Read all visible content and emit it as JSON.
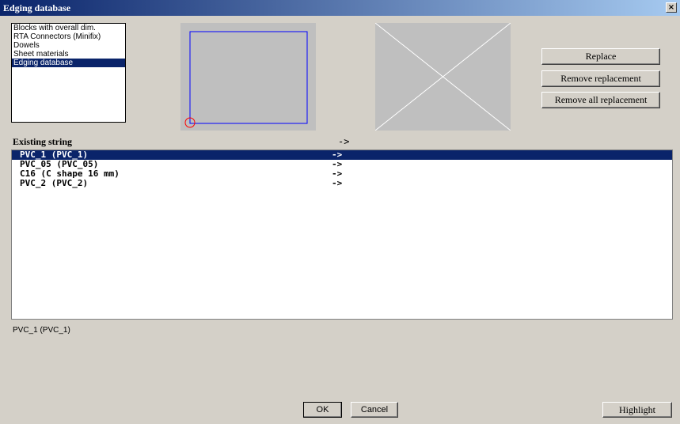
{
  "window": {
    "title": "Edging database",
    "close_glyph": "×"
  },
  "categories": {
    "items": [
      {
        "label": "Blocks with overall dim."
      },
      {
        "label": "RTA Connectors (Minifix)"
      },
      {
        "label": "Dowels"
      },
      {
        "label": "Sheet materials"
      },
      {
        "label": "Edging database"
      }
    ],
    "selected_index": 4
  },
  "buttons": {
    "replace": "Replace",
    "remove_replacement": "Remove replacement",
    "remove_all_replacement": "Remove all replacement",
    "ok": "OK",
    "cancel": "Cancel",
    "highlight": "Highlight"
  },
  "table": {
    "header_existing": "Existing string",
    "header_arrow": "->",
    "rows": [
      {
        "name": "PVC_1 (PVC_1)",
        "arrow": "->"
      },
      {
        "name": "PVC_05 (PVC_05)",
        "arrow": "->"
      },
      {
        "name": "C16 (C shape 16 mm)",
        "arrow": "->"
      },
      {
        "name": "PVC_2 (PVC_2)",
        "arrow": "->"
      }
    ],
    "selected_index": 0
  },
  "status_text": "PVC_1 (PVC_1)",
  "colors": {
    "title_bar": "#0a246a",
    "selection": "#0a246a",
    "preview_bg": "#bfbfbf",
    "rect_stroke": "#0000ff",
    "origin_marker": "#ff0000"
  }
}
